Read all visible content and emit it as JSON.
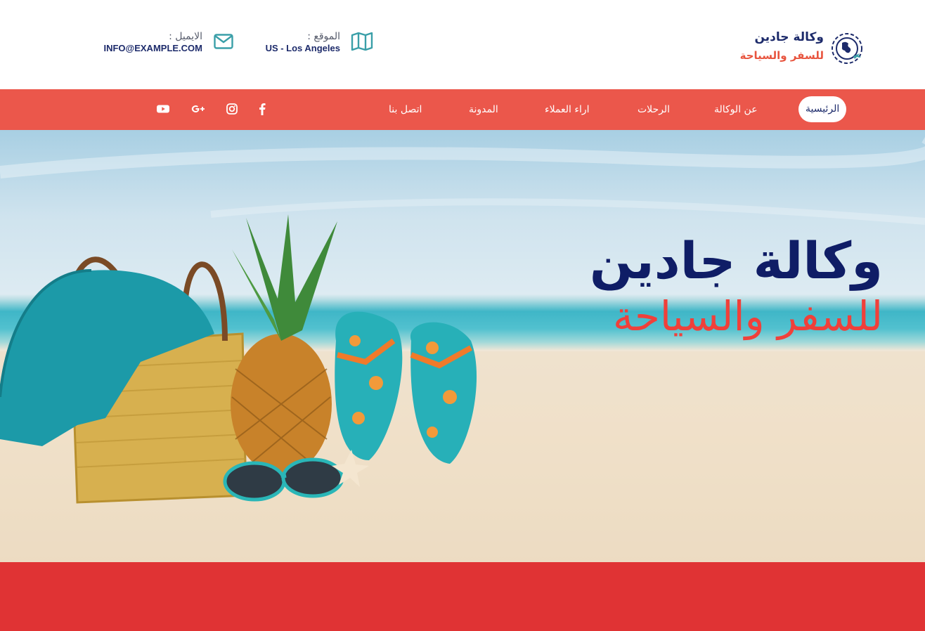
{
  "brand": {
    "name": "وكالة جادين",
    "tagline": "للسفر والسياحة",
    "logo_icon": "globe-plane-icon"
  },
  "contact": {
    "location_label": "الموقع :",
    "location_value": "US - Los Angeles",
    "location_icon": "map-icon",
    "email_label": "الايميل :",
    "email_value": "INFO@EXAMPLE.COM",
    "email_icon": "envelope-icon"
  },
  "nav": {
    "items": [
      {
        "label": "الرئيسية",
        "active": true
      },
      {
        "label": "عن الوكالة",
        "active": false
      },
      {
        "label": "الرحلات",
        "active": false
      },
      {
        "label": "اراء العملاء",
        "active": false
      },
      {
        "label": "المدونة",
        "active": false
      },
      {
        "label": "اتصل بنا",
        "active": false
      }
    ],
    "social": [
      "facebook-icon",
      "instagram-icon",
      "google-plus-icon",
      "youtube-icon"
    ]
  },
  "hero": {
    "title": "وكالة جادين",
    "subtitle": "للسفر والسياحة"
  },
  "colors": {
    "accent": "#eb574b",
    "navy": "#1d2b6b",
    "teal": "#3a9fa8",
    "footer": "#e03334"
  }
}
